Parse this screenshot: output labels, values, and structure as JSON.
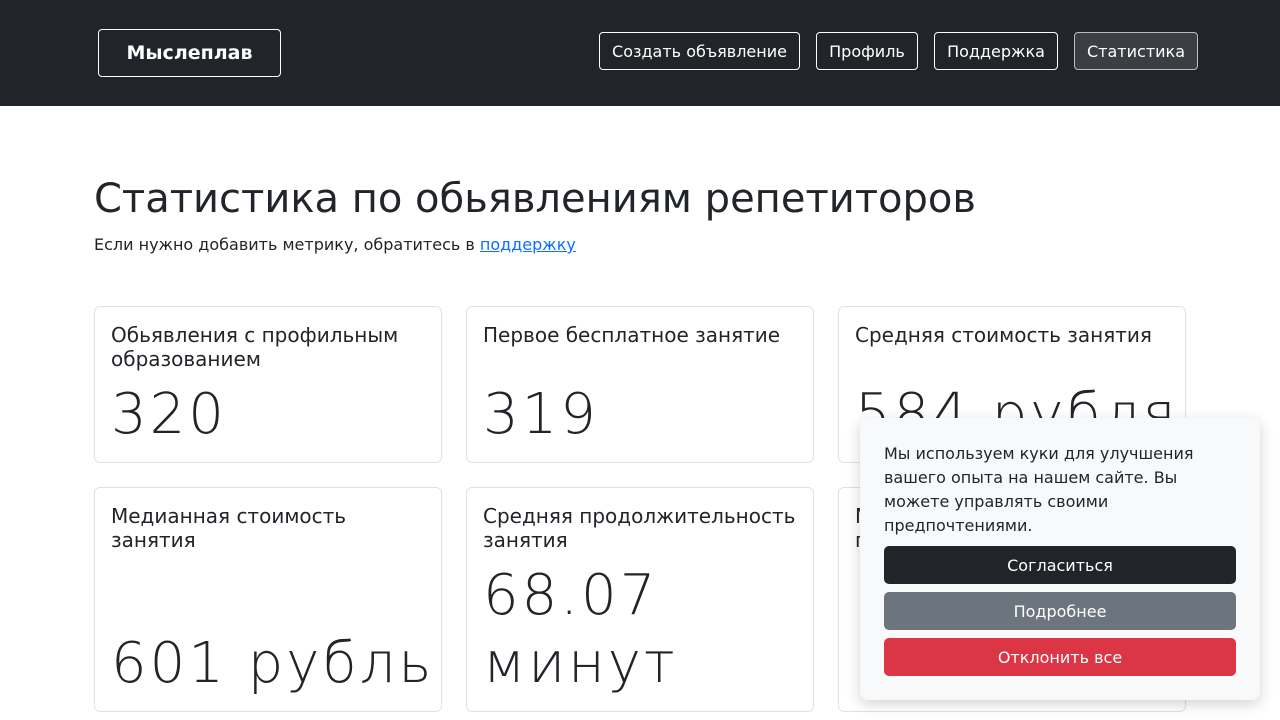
{
  "header": {
    "brand": "Мыслеплав",
    "nav": [
      {
        "label": "Создать объявление"
      },
      {
        "label": "Профиль"
      },
      {
        "label": "Поддержка"
      },
      {
        "label": "Статистика",
        "active": true
      }
    ]
  },
  "main": {
    "title": "Статистика по обьявлениям репетиторов",
    "subtitle_text": "Если нужно добавить метрику, обратитесь в ",
    "subtitle_link": "поддержку",
    "cards": [
      {
        "title": "Обьявления с профильным образованием",
        "value": "320"
      },
      {
        "title": "Первое бесплатное занятие",
        "value": "319"
      },
      {
        "title": "Средняя стоимость занятия",
        "value": "584 рубля"
      },
      {
        "title": "Медианная стоимость занятия",
        "value": "601 рубль"
      },
      {
        "title": "Средняя продолжительность занятия",
        "value_line1": "68.07",
        "value_line2": "минут"
      },
      {
        "title_partial": "М\nп"
      }
    ]
  },
  "cookie_banner": {
    "text": "Мы используем куки для улучшения вашего опыта на нашем сайте. Вы можете управлять своими предпочтениями.",
    "accept_label": "Согласиться",
    "details_label": "Подробнее",
    "reject_label": "Отклонить все"
  },
  "colors": {
    "navbar": "#212529",
    "link": "#0d6efd",
    "accept": "#212529",
    "details": "#6c757d",
    "reject": "#dc3545"
  }
}
